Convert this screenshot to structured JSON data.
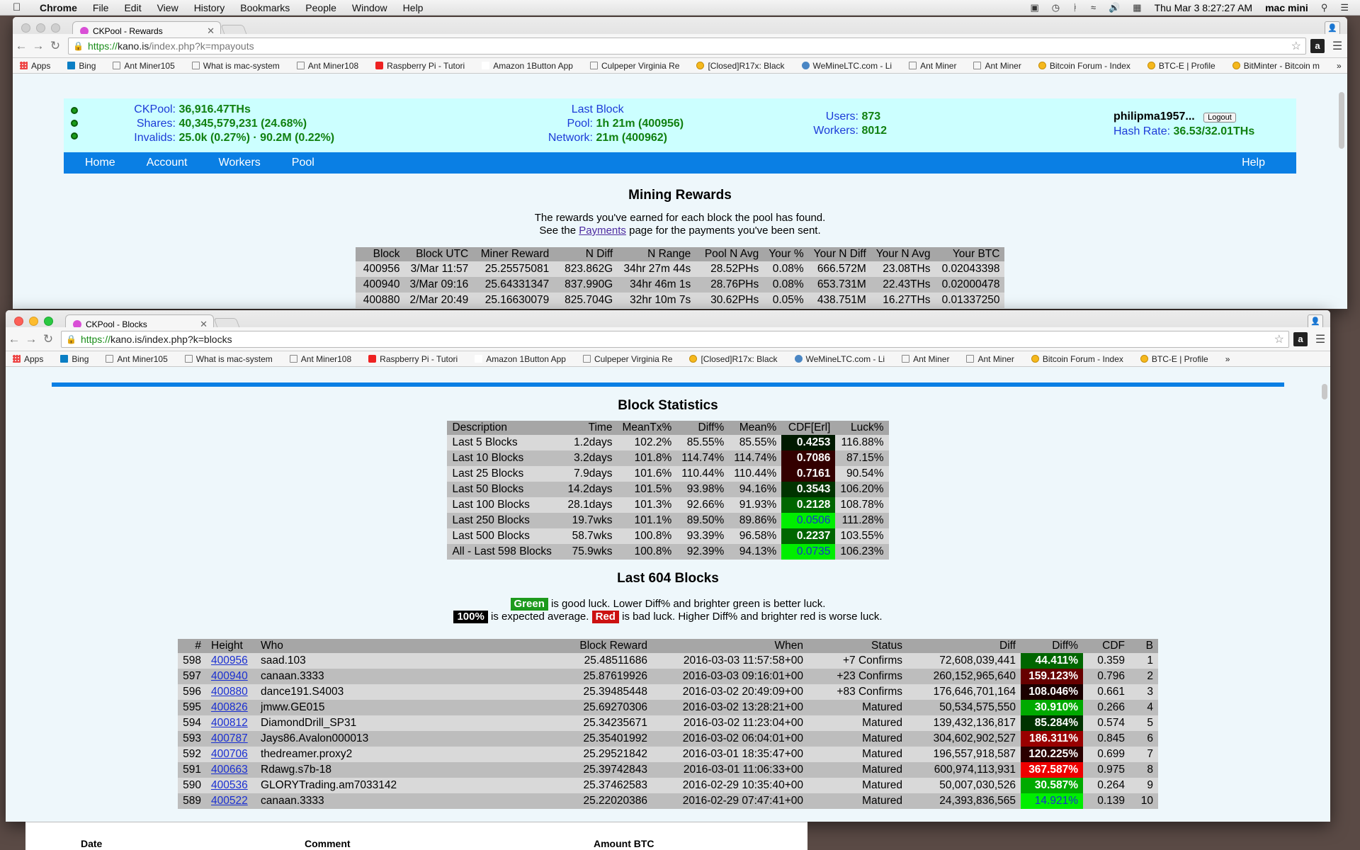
{
  "menubar": {
    "app": "Chrome",
    "menus": [
      "File",
      "Edit",
      "View",
      "History",
      "Bookmarks",
      "People",
      "Window",
      "Help"
    ],
    "clock": "Thu Mar 3  8:27:27 AM",
    "user": "mac mini"
  },
  "win1": {
    "tab_title": "CKPool - Rewards",
    "url_scheme": "https://",
    "url_host": "kano.is",
    "url_path": "/index.php?k=mpayouts",
    "bookmarks": [
      "Apps",
      "Bing",
      "Ant Miner105",
      "What is mac-system",
      "Ant Miner108",
      "Raspberry Pi - Tutori",
      "Amazon 1Button App",
      "Culpeper Virginia Re",
      "[Closed]R17x: Black",
      "WeMineLTC.com - Li",
      "Ant Miner",
      "Ant Miner",
      "Bitcoin Forum - Index",
      "BTC-E | Profile",
      "BitMinter - Bitcoin m"
    ],
    "header": {
      "ckpool_label": "CKPool:",
      "ckpool_value": "36,916.47THs",
      "shares_label": "Shares:",
      "shares_value": "40,345,579,231 (24.68%)",
      "invalids_label": "Invalids:",
      "invalids_value": "25.0k (0.27%) · 90.2M (0.22%)",
      "last_block_label": "Last Block",
      "pool_label": "Pool:",
      "pool_value": "1h 21m (400956)",
      "network_label": "Network:",
      "network_value": "21m (400962)",
      "users_label": "Users:",
      "users_value": "873",
      "workers_label": "Workers:",
      "workers_value": "8012",
      "username": "philipma1957...",
      "logout_label": "Logout",
      "hashrate_label": "Hash Rate:",
      "hashrate_value": "36.53/32.01THs"
    },
    "nav": [
      "Home",
      "Account",
      "Workers",
      "Pool"
    ],
    "nav_help": "Help",
    "title": "Mining Rewards",
    "intro_1": "The rewards you've earned for each block the pool has found.",
    "intro_2a": "See the ",
    "intro_link": "Payments",
    "intro_2b": " page for the payments you've been sent.",
    "rewards_headers": [
      "Block",
      "Block UTC",
      "Miner Reward",
      "N Diff",
      "N Range",
      "Pool N Avg",
      "Your %",
      "Your N Diff",
      "Your N Avg",
      "Your BTC"
    ],
    "rewards_rows": [
      [
        "400956",
        "3/Mar 11:57",
        "25.25575081",
        "823.862G",
        "34hr 27m 44s",
        "28.52PHs",
        "0.08%",
        "666.572M",
        "23.08THs",
        "0.02043398"
      ],
      [
        "400940",
        "3/Mar 09:16",
        "25.64331347",
        "837.990G",
        "34hr 46m 1s",
        "28.76PHs",
        "0.08%",
        "653.731M",
        "22.43THs",
        "0.02000478"
      ],
      [
        "400880",
        "2/Mar 20:49",
        "25.16630079",
        "825.704G",
        "32hr 10m 7s",
        "30.62PHs",
        "0.05%",
        "438.751M",
        "16.27THs",
        "0.01337250"
      ]
    ]
  },
  "win2": {
    "tab_title": "CKPool - Blocks",
    "url_scheme": "https://",
    "url_host": "kano.is",
    "url_path": "/index.php?k=blocks",
    "bookmarks": [
      "Apps",
      "Bing",
      "Ant Miner105",
      "What is mac-system",
      "Ant Miner108",
      "Raspberry Pi - Tutori",
      "Amazon 1Button App",
      "Culpeper Virginia Re",
      "[Closed]R17x: Black",
      "WeMineLTC.com - Li",
      "Ant Miner",
      "Ant Miner",
      "Bitcoin Forum - Index",
      "BTC-E | Profile"
    ],
    "stats_title": "Block Statistics",
    "stats_headers": [
      "Description",
      "Time",
      "MeanTx%",
      "Diff%",
      "Mean%",
      "CDF[Erl]",
      "Luck%"
    ],
    "stats_rows": [
      [
        "Last 5 Blocks",
        "1.2days",
        "102.2%",
        "85.55%",
        "85.55%",
        "0.4253",
        "116.88%"
      ],
      [
        "Last 10 Blocks",
        "3.2days",
        "101.8%",
        "114.74%",
        "114.74%",
        "0.7086",
        "87.15%"
      ],
      [
        "Last 25 Blocks",
        "7.9days",
        "101.6%",
        "110.44%",
        "110.44%",
        "0.7161",
        "90.54%"
      ],
      [
        "Last 50 Blocks",
        "14.2days",
        "101.5%",
        "93.98%",
        "94.16%",
        "0.3543",
        "106.20%"
      ],
      [
        "Last 100 Blocks",
        "28.1days",
        "101.3%",
        "92.66%",
        "91.93%",
        "0.2128",
        "108.78%"
      ],
      [
        "Last 250 Blocks",
        "19.7wks",
        "101.1%",
        "89.50%",
        "89.86%",
        "0.0506",
        "111.28%"
      ],
      [
        "Last 500 Blocks",
        "58.7wks",
        "100.8%",
        "93.39%",
        "96.58%",
        "0.2237",
        "103.55%"
      ],
      [
        "All - Last 598 Blocks",
        "75.9wks",
        "100.8%",
        "92.39%",
        "94.13%",
        "0.0735",
        "106.23%"
      ]
    ],
    "stats_cdf_colors": [
      {
        "bg": "#001a00",
        "fg": "#ffffff"
      },
      {
        "bg": "#330000",
        "fg": "#ffffff"
      },
      {
        "bg": "#330000",
        "fg": "#ffffff"
      },
      {
        "bg": "#003300",
        "fg": "#ffffff"
      },
      {
        "bg": "#006600",
        "fg": "#ffffff"
      },
      {
        "bg": "#00ee00",
        "fg": "#1a2fd1"
      },
      {
        "bg": "#006600",
        "fg": "#ffffff"
      },
      {
        "bg": "#00ee00",
        "fg": "#1a2fd1"
      }
    ],
    "last_title": "Last 604 Blocks",
    "legend_green": "Green",
    "legend_1": " is good luck. Lower Diff% and brighter green is better luck.",
    "legend_100": "100%",
    "legend_2": " is expected average. ",
    "legend_red": "Red",
    "legend_3": " is bad luck. Higher Diff% and brighter red is worse luck.",
    "blocks_headers": [
      "#",
      "Height",
      "Who",
      "Block Reward",
      "When",
      "Status",
      "Diff",
      "Diff%",
      "CDF",
      "B"
    ],
    "blocks_rows": [
      [
        "598",
        "400956",
        "saad.103",
        "25.48511686",
        "2016-03-03 11:57:58+00",
        "+7 Confirms",
        "72,608,039,441",
        "44.411%",
        "0.359",
        "1"
      ],
      [
        "597",
        "400940",
        "canaan.3333",
        "25.87619926",
        "2016-03-03 09:16:01+00",
        "+23 Confirms",
        "260,152,965,640",
        "159.123%",
        "0.796",
        "2"
      ],
      [
        "596",
        "400880",
        "dance191.S4003",
        "25.39485448",
        "2016-03-02 20:49:09+00",
        "+83 Confirms",
        "176,646,701,164",
        "108.046%",
        "0.661",
        "3"
      ],
      [
        "595",
        "400826",
        "jmww.GE015",
        "25.69270306",
        "2016-03-02 13:28:21+00",
        "Matured",
        "50,534,575,550",
        "30.910%",
        "0.266",
        "4"
      ],
      [
        "594",
        "400812",
        "DiamondDrill_SP31",
        "25.34235671",
        "2016-03-02 11:23:04+00",
        "Matured",
        "139,432,136,817",
        "85.284%",
        "0.574",
        "5"
      ],
      [
        "593",
        "400787",
        "Jays86.Avalon000013",
        "25.35401992",
        "2016-03-02 06:04:01+00",
        "Matured",
        "304,602,902,527",
        "186.311%",
        "0.845",
        "6"
      ],
      [
        "592",
        "400706",
        "thedreamer.proxy2",
        "25.29521842",
        "2016-03-01 18:35:47+00",
        "Matured",
        "196,557,918,587",
        "120.225%",
        "0.699",
        "7"
      ],
      [
        "591",
        "400663",
        "Rdawg.s7b-18",
        "25.39742843",
        "2016-03-01 11:06:33+00",
        "Matured",
        "600,974,113,931",
        "367.587%",
        "0.975",
        "8"
      ],
      [
        "590",
        "400536",
        "GLORYTrading.am7033142",
        "25.37462583",
        "2016-02-29 10:35:40+00",
        "Matured",
        "50,007,030,526",
        "30.587%",
        "0.264",
        "9"
      ],
      [
        "589",
        "400522",
        "canaan.3333",
        "25.22020386",
        "2016-02-29 07:47:41+00",
        "Matured",
        "24,393,836,565",
        "14.921%",
        "0.139",
        "10"
      ]
    ],
    "blocks_diffpct_colors": [
      {
        "bg": "#006600",
        "fg": "#ffffff"
      },
      {
        "bg": "#660000",
        "fg": "#ffffff"
      },
      {
        "bg": "#1a0000",
        "fg": "#ffffff"
      },
      {
        "bg": "#00aa00",
        "fg": "#ffffff"
      },
      {
        "bg": "#003300",
        "fg": "#ffffff"
      },
      {
        "bg": "#990000",
        "fg": "#ffffff"
      },
      {
        "bg": "#2a0000",
        "fg": "#ffffff"
      },
      {
        "bg": "#ee0000",
        "fg": "#ffffff"
      },
      {
        "bg": "#00aa00",
        "fg": "#ffffff"
      },
      {
        "bg": "#00ee00",
        "fg": "#1a2fd1"
      }
    ]
  },
  "behind": {
    "col_date": "Date",
    "col_comment": "Comment",
    "col_amount": "Amount BTC"
  }
}
